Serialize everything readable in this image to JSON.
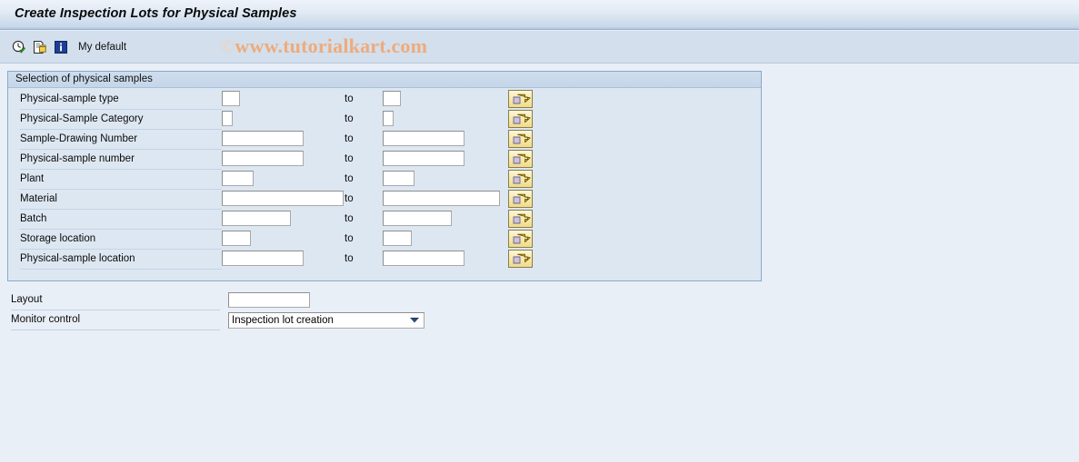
{
  "window": {
    "title": "Create Inspection Lots for Physical Samples"
  },
  "toolbar": {
    "execute_icon": "execute-clock-icon",
    "copy_icon": "copy-variant-icon",
    "info_icon": "info-icon",
    "my_default_label": "My default"
  },
  "watermark": {
    "copyright": "©",
    "text": "www.tutorialkart.com"
  },
  "selection_group": {
    "title": "Selection of physical samples",
    "to_label": "to",
    "select_options_icon": "multiple-selection-arrow-icon",
    "rows": [
      {
        "label": "Physical-sample type",
        "from_value": "",
        "to_value": "",
        "from_width": 20,
        "to_width": 20
      },
      {
        "label": "Physical-Sample Category",
        "from_value": "",
        "to_value": "",
        "from_width": 12,
        "to_width": 12
      },
      {
        "label": "Sample-Drawing Number",
        "from_value": "",
        "to_value": "",
        "from_width": 90,
        "to_width": 90
      },
      {
        "label": "Physical-sample number",
        "from_value": "",
        "to_value": "",
        "from_width": 90,
        "to_width": 90
      },
      {
        "label": "Plant",
        "from_value": "",
        "to_value": "",
        "from_width": 35,
        "to_width": 35
      },
      {
        "label": "Material",
        "from_value": "",
        "to_value": "",
        "from_width": 134,
        "to_width": 129
      },
      {
        "label": "Batch",
        "from_value": "",
        "to_value": "",
        "from_width": 76,
        "to_width": 76
      },
      {
        "label": "Storage location",
        "from_value": "",
        "to_value": "",
        "from_width": 32,
        "to_width": 32
      },
      {
        "label": "Physical-sample location",
        "from_value": "",
        "to_value": "",
        "from_width": 90,
        "to_width": 90
      }
    ]
  },
  "bottom": {
    "layout_label": "Layout",
    "layout_value": "",
    "monitor_label": "Monitor control",
    "monitor_value": "Inspection lot creation",
    "monitor_options": [
      "Inspection lot creation"
    ],
    "dropdown_icon": "chevron-down-icon"
  },
  "colors": {
    "page_background": "#e9eff7",
    "group_background": "#dde7f2",
    "title_bar": "#c8d8ea",
    "toolbar": "#d3dfec",
    "group_border": "#8aa9c9",
    "watermark": "#eeab7c",
    "arrow_button": "#f7e9a8"
  }
}
